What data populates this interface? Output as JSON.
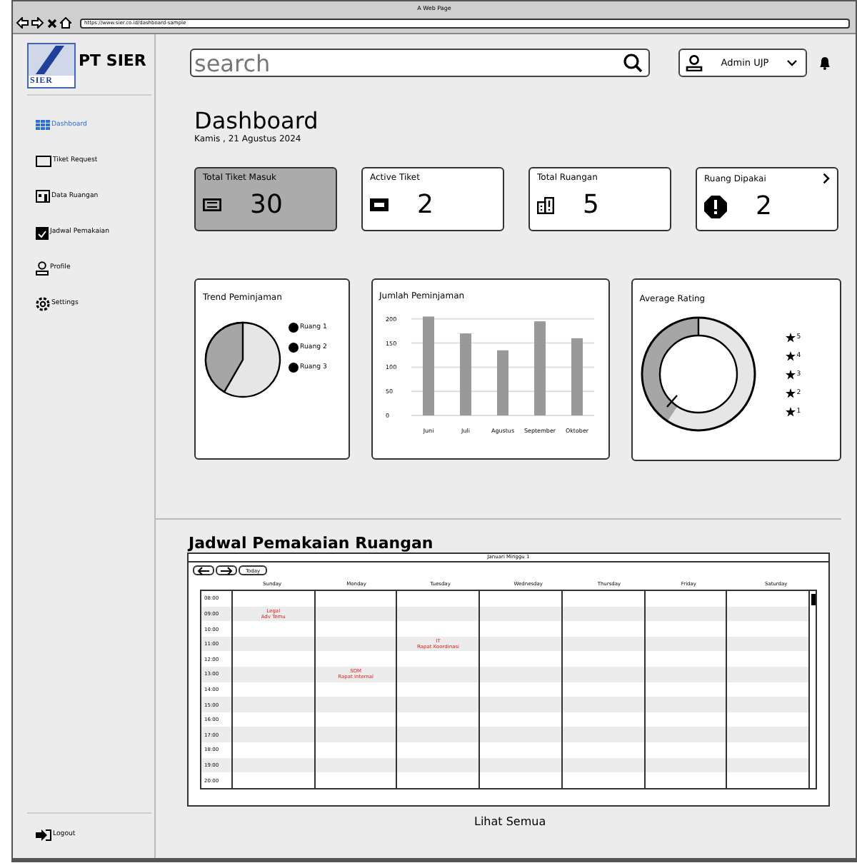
{
  "browser": {
    "title": "A Web Page",
    "url": "https://www.sier.co.id/dashboard-sample"
  },
  "sidebar": {
    "brand": "PT SIER",
    "logo_text": "SIER",
    "items": [
      {
        "label": "Dashboard",
        "kind": "grid",
        "selected": true
      },
      {
        "label": "Tiket Request",
        "kind": "ticket",
        "selected": false
      },
      {
        "label": "Data Ruangan",
        "kind": "building",
        "selected": false
      },
      {
        "label": "Jadwal Pemakaian",
        "kind": "calendar",
        "selected": false
      },
      {
        "label": "Profile",
        "kind": "user",
        "selected": false
      },
      {
        "label": "Settings",
        "kind": "gear",
        "selected": false
      }
    ],
    "logout": "Logout"
  },
  "header": {
    "search": {
      "placeholder": "search"
    },
    "user": "Admin UJP"
  },
  "page": {
    "title": "Dashboard",
    "date": "Kamis , 21 Agustus 2024"
  },
  "stats": [
    {
      "label": "Total Tiket Masuk",
      "value": "30",
      "kind": "ticket",
      "selected": true,
      "has_link": false
    },
    {
      "label": "Active Tiket",
      "value": "2",
      "kind": "ticket-solid",
      "selected": false,
      "has_link": false
    },
    {
      "label": "Total Ruangan",
      "value": "5",
      "kind": "building",
      "selected": false,
      "has_link": false
    },
    {
      "label": "Ruang Dipakai",
      "value": "2",
      "kind": "alert",
      "selected": false,
      "has_link": true
    }
  ],
  "trend": {
    "title": "Trend Peminjaman",
    "legend": [
      "Ruang 1",
      "Ruang 2",
      "Ruang 3"
    ]
  },
  "loans": {
    "title": "Jumlah Peminjaman",
    "chart_data": {
      "type": "bar",
      "categories": [
        "Juni",
        "Juli",
        "Agustus",
        "September",
        "Oktober"
      ],
      "values": [
        205,
        170,
        135,
        195,
        160
      ],
      "ylim": [
        0,
        210
      ],
      "yticks": [
        0,
        50,
        100,
        150,
        200
      ],
      "grid": true
    }
  },
  "rating": {
    "title": "Average Rating",
    "legend": [
      "5",
      "4",
      "3",
      "2",
      "1"
    ]
  },
  "schedule": {
    "title": "Jadwal Pemakaian Ruangan",
    "period": "Januari Minggu 1",
    "today": "Today",
    "days": [
      "Sunday",
      "Monday",
      "Tuesday",
      "Wednesday",
      "Thursday",
      "Friday",
      "Saturday"
    ],
    "rows": [
      {
        "time": "08:00",
        "cells": [
          {
            "kind": "empty"
          },
          {
            "kind": "empty"
          },
          {
            "kind": "empty"
          },
          {
            "kind": "empty"
          },
          {
            "kind": "empty"
          },
          {
            "kind": "empty"
          },
          {
            "kind": "empty"
          }
        ]
      },
      {
        "time": "09:00",
        "cells": [
          {
            "kind": "event",
            "lines": [
              "Legal",
              "Adv Temu"
            ]
          },
          {
            "kind": "empty"
          },
          {
            "kind": "empty"
          },
          {
            "kind": "empty"
          },
          {
            "kind": "empty"
          },
          {
            "kind": "empty"
          },
          {
            "kind": "empty"
          }
        ]
      },
      {
        "time": "10:00",
        "cells": [
          {
            "kind": "empty"
          },
          {
            "kind": "empty"
          },
          {
            "kind": "empty"
          },
          {
            "kind": "empty"
          },
          {
            "kind": "empty"
          },
          {
            "kind": "empty"
          },
          {
            "kind": "empty"
          }
        ]
      },
      {
        "time": "11:00",
        "cells": [
          {
            "kind": "empty"
          },
          {
            "kind": "empty"
          },
          {
            "kind": "event",
            "lines": [
              "IT",
              "Rapat Koordinasi"
            ]
          },
          {
            "kind": "empty"
          },
          {
            "kind": "empty"
          },
          {
            "kind": "empty"
          },
          {
            "kind": "empty"
          }
        ]
      },
      {
        "time": "12:00",
        "cells": [
          {
            "kind": "empty"
          },
          {
            "kind": "empty"
          },
          {
            "kind": "empty"
          },
          {
            "kind": "empty"
          },
          {
            "kind": "empty"
          },
          {
            "kind": "empty"
          },
          {
            "kind": "empty"
          }
        ]
      },
      {
        "time": "13:00",
        "cells": [
          {
            "kind": "empty"
          },
          {
            "kind": "event",
            "lines": [
              "SDM",
              "Rapat Internal"
            ]
          },
          {
            "kind": "empty"
          },
          {
            "kind": "empty"
          },
          {
            "kind": "empty"
          },
          {
            "kind": "empty"
          },
          {
            "kind": "empty"
          }
        ]
      },
      {
        "time": "14:00",
        "cells": [
          {
            "kind": "empty"
          },
          {
            "kind": "empty"
          },
          {
            "kind": "empty"
          },
          {
            "kind": "empty"
          },
          {
            "kind": "empty"
          },
          {
            "kind": "empty"
          },
          {
            "kind": "empty"
          }
        ]
      },
      {
        "time": "15:00",
        "cells": [
          {
            "kind": "empty"
          },
          {
            "kind": "empty"
          },
          {
            "kind": "empty"
          },
          {
            "kind": "empty"
          },
          {
            "kind": "empty"
          },
          {
            "kind": "empty"
          },
          {
            "kind": "empty"
          }
        ]
      },
      {
        "time": "16:00",
        "cells": [
          {
            "kind": "empty"
          },
          {
            "kind": "empty"
          },
          {
            "kind": "empty"
          },
          {
            "kind": "empty"
          },
          {
            "kind": "empty"
          },
          {
            "kind": "empty"
          },
          {
            "kind": "empty"
          }
        ]
      },
      {
        "time": "17:00",
        "cells": [
          {
            "kind": "empty"
          },
          {
            "kind": "empty"
          },
          {
            "kind": "empty"
          },
          {
            "kind": "empty"
          },
          {
            "kind": "empty"
          },
          {
            "kind": "empty"
          },
          {
            "kind": "empty"
          }
        ]
      },
      {
        "time": "18:00",
        "cells": [
          {
            "kind": "empty"
          },
          {
            "kind": "empty"
          },
          {
            "kind": "empty"
          },
          {
            "kind": "empty"
          },
          {
            "kind": "empty"
          },
          {
            "kind": "empty"
          },
          {
            "kind": "empty"
          }
        ]
      },
      {
        "time": "19:00",
        "cells": [
          {
            "kind": "empty"
          },
          {
            "kind": "empty"
          },
          {
            "kind": "empty"
          },
          {
            "kind": "empty"
          },
          {
            "kind": "empty"
          },
          {
            "kind": "empty"
          },
          {
            "kind": "empty"
          }
        ]
      },
      {
        "time": "20:00",
        "cells": [
          {
            "kind": "empty"
          },
          {
            "kind": "empty"
          },
          {
            "kind": "empty"
          },
          {
            "kind": "empty"
          },
          {
            "kind": "empty"
          },
          {
            "kind": "empty"
          },
          {
            "kind": "empty"
          }
        ]
      }
    ],
    "link": "Lihat Semua"
  }
}
